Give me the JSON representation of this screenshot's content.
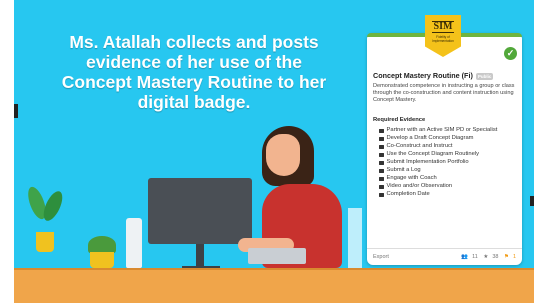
{
  "headline": "Ms. Atallah collects and posts evidence of her use of the Concept Mastery Routine to her digital badge.",
  "badge_card": {
    "badge_logo_text": "SIM",
    "badge_sub_text": "Fidelity of Implementation",
    "title": "Concept Mastery Routine (Fi)",
    "visibility": "Public",
    "description": "Demonstrated competence in instructing a group or class through the co-construction and content instruction using Concept Mastery.",
    "required_evidence_heading": "Required Evidence",
    "evidence_items": [
      "Partner with an Active SIM PD or Specialist",
      "Develop a Draft Concept Diagram",
      "Co-Construct and Instruct",
      "Use the Concept Diagram Routinely",
      "Submit Implementation Portfolio",
      "Submit a Log",
      "Engage with Coach",
      "Video and/or Observation",
      "Completion Date"
    ],
    "footer": {
      "export_label": "Export",
      "earners_count": "11",
      "stars_count": "38",
      "flags_count": "1"
    },
    "accent_color": "#6fb43f",
    "badge_color": "#f4c21a"
  },
  "colors": {
    "background": "#27c7f0",
    "desk": "#f0a54a"
  }
}
